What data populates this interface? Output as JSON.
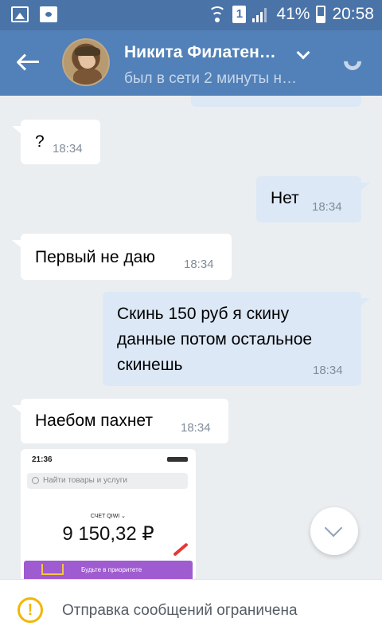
{
  "status_bar": {
    "battery": "41%",
    "sim_slot": "1",
    "time": "20:58",
    "icons": [
      "gallery-icon",
      "game-icon",
      "wifi-icon",
      "sim-icon",
      "signal-icon",
      "battery-icon"
    ]
  },
  "header": {
    "name": "Никита Филатен…",
    "status": "был в сети 2 минуты н…",
    "colors": {
      "bar": "#5181b8",
      "status_bar": "#4a73a8"
    }
  },
  "messages": [
    {
      "direction": "in",
      "text": "?",
      "time": "18:34"
    },
    {
      "direction": "out",
      "text": "Нет",
      "time": "18:34"
    },
    {
      "direction": "in",
      "text": "Первый не даю",
      "time": "18:34"
    },
    {
      "direction": "out",
      "text_line1": "Скинь 150 руб я скину",
      "text_line2": "данные потом остальное",
      "text_line3": "скинешь",
      "time": "18:34"
    },
    {
      "direction": "in",
      "text": "Наебом пахнет",
      "time": "18:34"
    }
  ],
  "image_message": {
    "time": "21:36",
    "search_placeholder": "Найти товары и услуги",
    "account_label": "СЧЕТ QIWI ⌄",
    "amount": "9 150,32 ₽",
    "banner_text": "Будьте в приоритете"
  },
  "bottom": {
    "warning_text": "Отправка сообщений ограничена",
    "warning_symbol": "!"
  },
  "colors": {
    "incoming": "#ffffff",
    "outgoing": "#dce8f6",
    "background": "#ebeef1",
    "warning": "#f2b705"
  }
}
